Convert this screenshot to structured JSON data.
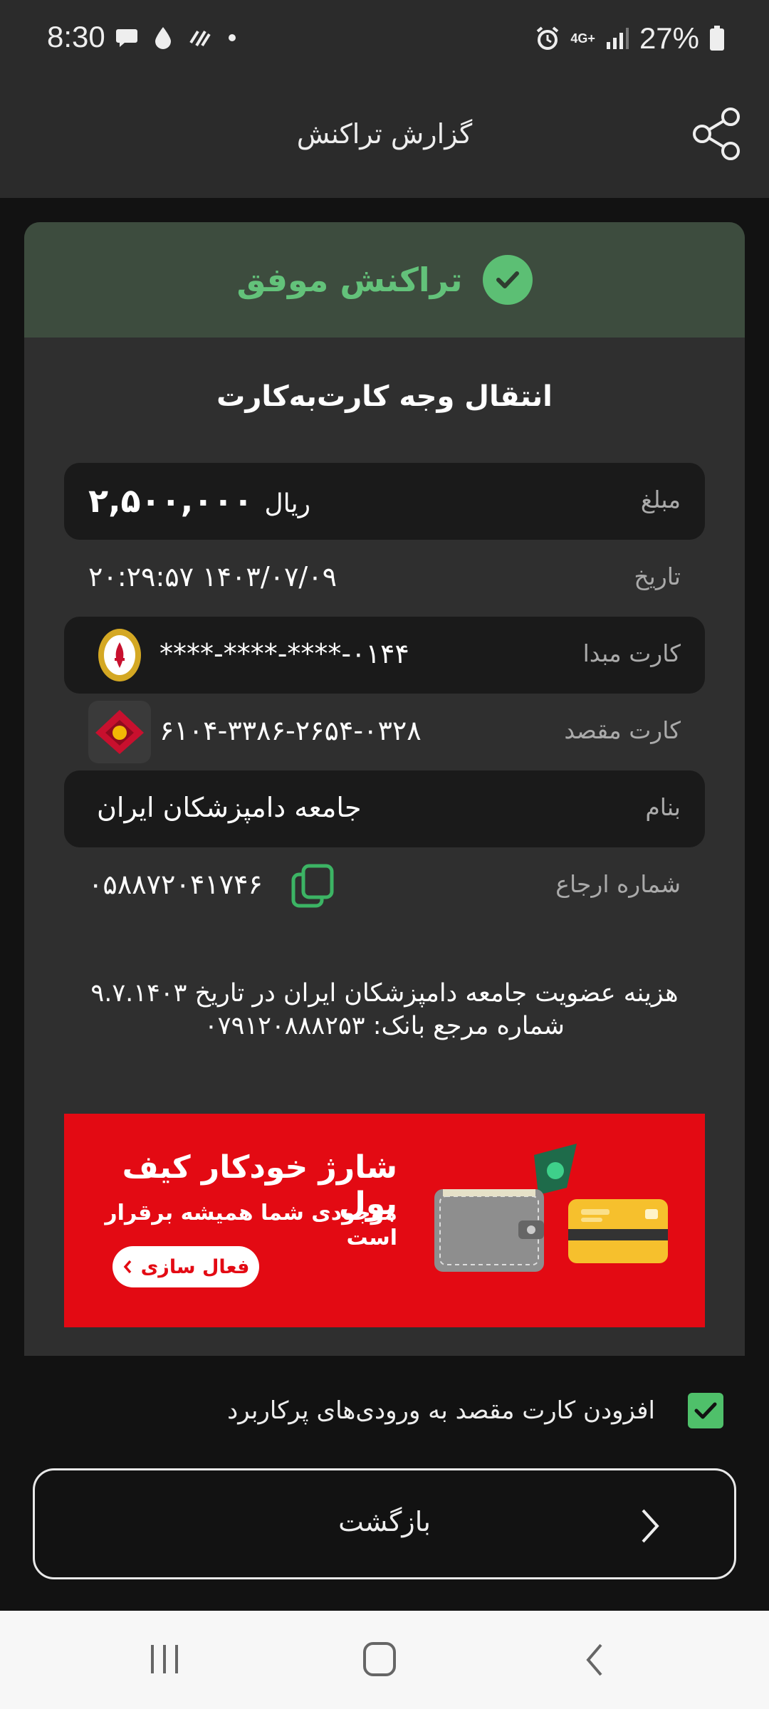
{
  "status_bar": {
    "time": "8:30",
    "network": "4G+",
    "battery": "27%"
  },
  "header": {
    "title": "گزارش تراکنش"
  },
  "result": {
    "status": "تراکنش موفق",
    "status_color": "#63c27a"
  },
  "transaction": {
    "title": "انتقال وجه کارت‌به‌کارت",
    "amount_label": "مبلغ",
    "amount": "۲,۵۰۰,۰۰۰",
    "currency": "ریال",
    "date_label": "تاریخ",
    "date": "۱۴۰۳/۰۷/۰۹  ۲۰:۲۹:۵۷",
    "source_label": "کارت مبدا",
    "source_card": "****-****-****-۰۱۴۴",
    "dest_label": "کارت مقصد",
    "dest_card": "۶۱۰۴-۳۳۸۶-۲۶۵۴-۰۳۲۸",
    "name_label": "بنام",
    "name": "جامعه دامپزشکان ایران",
    "ref_label": "شماره ارجاع",
    "ref": "۰۵۸۸۷۲۰۴۱۷۴۶"
  },
  "description": {
    "line1": "هزینه عضویت جامعه دامپزشکان ایران در تاریخ ۹.۷.۱۴۰۳",
    "line2": "شماره مرجع بانک: ۰۷۹۱۲۰۸۸۸۲۵۳"
  },
  "banner": {
    "title": "شارژ خودکار کیف پول",
    "subtitle": "موجودی شما همیشه برقرار است",
    "button": "فعال سازی",
    "color": "#e30a13"
  },
  "options": {
    "save_dest_label": "افزودن کارت مقصد به ورودی‌های پرکاربرد",
    "save_dest_checked": true
  },
  "actions": {
    "back_label": "بازگشت"
  }
}
